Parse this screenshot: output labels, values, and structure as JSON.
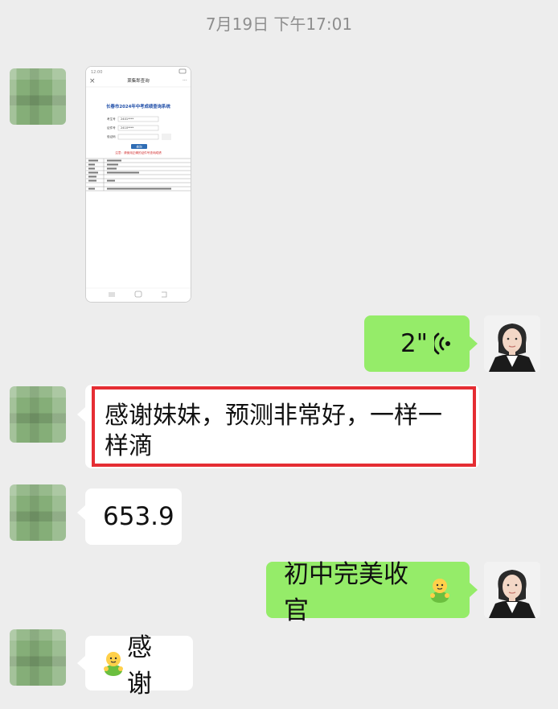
{
  "timestamp": "7月19日 下午17:01",
  "messages": {
    "voice": {
      "duration": "2\""
    },
    "thanks_long": "感谢妹妹，预测非常好，一样一样滴",
    "score": "653.9",
    "junior_high": "初中完美收官",
    "thanks_short": "感谢"
  },
  "screenshot": {
    "header_title": "莱集郎查询",
    "page_title": "长春市2024年中考成绩查询系统",
    "form_labels": [
      "考生号",
      "证件号",
      "验证码"
    ],
    "form_values": [
      "2401****",
      "2410****",
      ""
    ],
    "query_button": "查询",
    "notice": "注意：请使用正确的证件号查询成绩"
  },
  "colors": {
    "background": "#ededed",
    "bubble_in": "#ffffff",
    "bubble_out": "#95ec69",
    "highlight": "#e52d33"
  },
  "icons": {
    "voice": "voice-wave-icon",
    "emoji": "tuzi-emoji-icon"
  }
}
